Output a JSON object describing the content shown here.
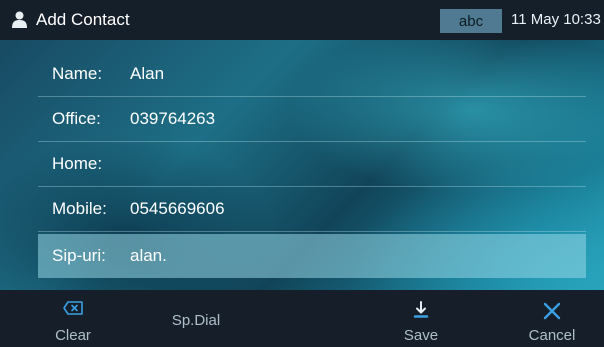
{
  "header": {
    "title": "Add Contact",
    "input_mode": "abc",
    "clock": "11 May 10:33",
    "icon": "person-icon"
  },
  "form": {
    "fields": [
      {
        "label": "Name:",
        "value": "Alan"
      },
      {
        "label": "Office:",
        "value": "039764263"
      },
      {
        "label": "Home:",
        "value": ""
      },
      {
        "label": "Mobile:",
        "value": "0545669606"
      },
      {
        "label": "Sip-uri:",
        "value": "alan."
      }
    ],
    "active_field": "Sip-uri:"
  },
  "softkeys": [
    {
      "label": "Clear",
      "icon": "backspace-icon"
    },
    {
      "label": "Sp.Dial",
      "icon": ""
    },
    {
      "label": "Save",
      "icon": "save-icon"
    },
    {
      "label": "Cancel",
      "icon": "close-icon"
    }
  ],
  "colors": {
    "bar_background": "#151f2a",
    "active_row": "#96d7e6",
    "input_mode_badge": "#4f7a91",
    "accent_blue": "#3aa0e6"
  }
}
